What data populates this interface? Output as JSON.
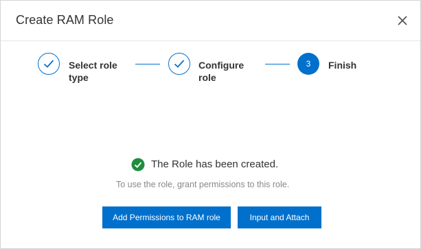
{
  "dialog": {
    "title": "Create RAM Role",
    "close_icon": "close-icon"
  },
  "steps": [
    {
      "label_line1": "Select role",
      "label_line2": "type",
      "status": "done",
      "icon": "check-icon"
    },
    {
      "label_line1": "Configure",
      "label_line2": "role",
      "status": "done",
      "icon": "check-icon"
    },
    {
      "number": "3",
      "label_line1": "Finish",
      "label_line2": "",
      "status": "current"
    }
  ],
  "result": {
    "icon": "success-check-icon",
    "message": "The Role has been created.",
    "hint": "To use the role, grant permissions to this role."
  },
  "actions": {
    "add_permissions_label": "Add Permissions to RAM role",
    "input_attach_label": "Input and Attach"
  },
  "colors": {
    "accent": "#0070cc",
    "success": "#1e8e3e",
    "text": "#333333",
    "muted": "#888888"
  }
}
